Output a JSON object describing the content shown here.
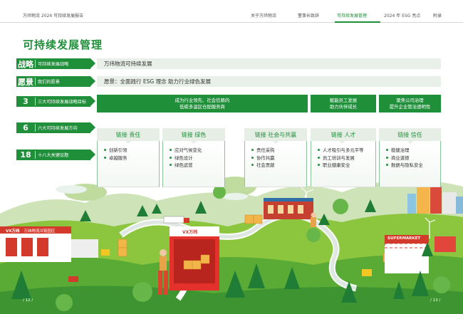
{
  "header": {
    "brand": "万纬物流 2024 可持续发展报告",
    "nav": [
      "关于万纬物流",
      "董事长致辞",
      "可持续发展管理",
      "2024 年 ESG 亮点",
      "附录"
    ],
    "active_index": 2
  },
  "page_title": "可持续发展管理",
  "rows": {
    "strategy": {
      "big": "战略",
      "small": "可持续发展战略",
      "content": "万纬物流可持续发展"
    },
    "vision": {
      "big": "愿景",
      "small": "我们的愿景",
      "content": "愿景：全面践行 ESG 理念 助力行业绿色发展"
    },
    "goals": {
      "big": "3",
      "small": "三大可持续发展战略目标",
      "items": [
        "成为行业领先、社会信赖的\n低碳多温区仓配服务商",
        "赋能员工发展\n助力伙伴成长",
        "聚焦公司治理\n提升企业管治透明性"
      ]
    },
    "directions": {
      "big": "6",
      "small": "六大可持续发展方向"
    },
    "topics": {
      "big": "18",
      "small": "十八大关键议题"
    }
  },
  "pillars": [
    {
      "title": "链接 责任",
      "items": [
        "创新引领",
        "卓越服务"
      ]
    },
    {
      "title": "链接 绿色",
      "items": [
        "应对气候变化",
        "绿色设计",
        "绿色运营"
      ]
    },
    {
      "title": "链接 社会与共赢",
      "items": [
        "责任采购",
        "协作共赢",
        "社会贡献"
      ]
    },
    {
      "title": "链接 人才",
      "items": [
        "人才吸引与多元平等",
        "员工培训与发展",
        "职业健康安全"
      ]
    },
    {
      "title": "链接 信任",
      "items": [
        "稳健治理",
        "商业道德",
        "数据与隐私安全"
      ]
    }
  ],
  "scene": {
    "sign_text": "万纬物流冷链园区",
    "logo_text": "VX万纬",
    "supermarket": "SUPERMARKET"
  },
  "page_numbers": {
    "left": "/ 12 /",
    "right": "/ 13 /"
  },
  "colors": {
    "green": "#1f8f3a",
    "light": "#e9efe9"
  }
}
